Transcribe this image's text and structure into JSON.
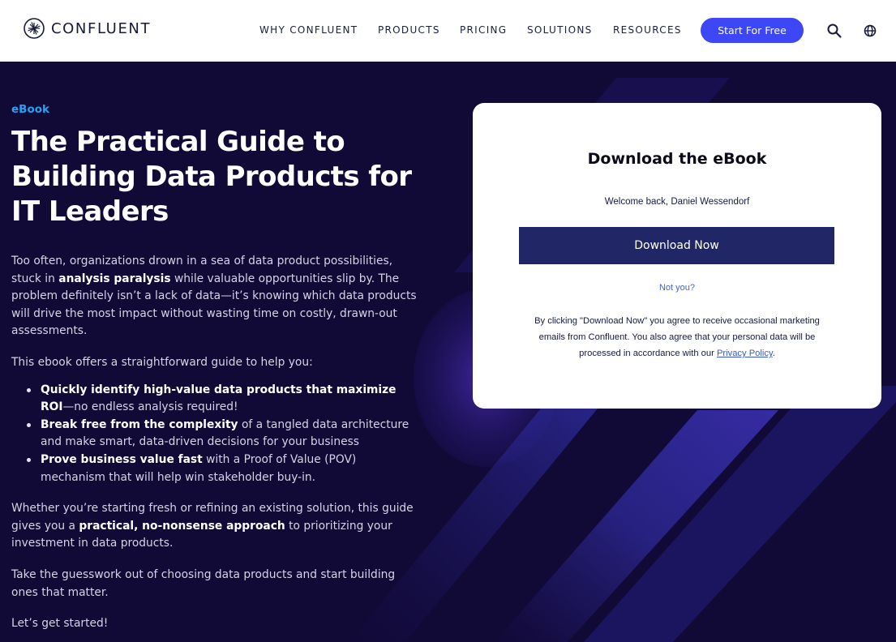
{
  "header": {
    "brand": "CONFLUENT",
    "nav": [
      "WHY CONFLUENT",
      "PRODUCTS",
      "PRICING",
      "SOLUTIONS",
      "RESOURCES"
    ],
    "cta": "Start For Free",
    "icons": [
      "search-icon",
      "globe-icon"
    ]
  },
  "hero": {
    "label": "eBook",
    "title": "The Practical Guide to Building Data Products for IT Leaders",
    "p1_a": "Too often, organizations drown in a sea of data product possibilities, stuck in ",
    "p1_b": "analysis paralysis",
    "p1_c": " while valuable opportunities slip by. The problem definitely isn’t a lack of data—it’s knowing which data products will drive the most impact without wasting time on costly, drawn-out assessments.",
    "p2": "This ebook offers a straightforward guide to help you:",
    "bullets": [
      {
        "bold": "Quickly identify high-value data products that maximize ROI",
        "rest": "—no endless analysis required!"
      },
      {
        "bold": "Break free from the complexity",
        "rest": " of a tangled data architecture and make smart, data-driven decisions for your business"
      },
      {
        "bold": "Prove business value fast",
        "rest": " with a Proof of Value (POV) mechanism that will help win stakeholder buy-in."
      }
    ],
    "p3_a": "Whether you’re starting fresh or refining an existing solution, this guide gives you a ",
    "p3_b": "practical, no-nonsense approach",
    "p3_c": " to prioritizing your investment in data products.",
    "p4": "Take the guesswork out of choosing data products and start building ones that matter.",
    "p5": "Let’s get started!"
  },
  "card": {
    "title": "Download the eBook",
    "welcome": "Welcome back, Daniel Wessendorf",
    "button": "Download Now",
    "not_you": "Not you?",
    "fine_a": "By clicking \"Download Now\" you agree to receive occasional marketing emails from Confluent. You also agree that your personal data will be processed in accordance with our ",
    "privacy_link": "Privacy Policy",
    "fine_b": "."
  },
  "colors": {
    "accent": "#3d47f5",
    "label": "#24a3f5",
    "hero_bg": "#110936",
    "button_dark": "#212766"
  }
}
